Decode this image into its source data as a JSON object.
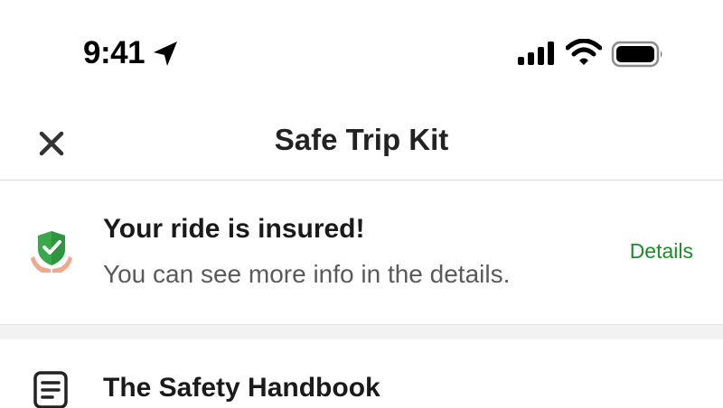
{
  "status_bar": {
    "time": "9:41",
    "icons": [
      "location-arrow-icon",
      "cellular-signal-icon",
      "wifi-icon",
      "battery-icon"
    ]
  },
  "header": {
    "title": "Safe Trip Kit",
    "close_icon": "close-icon"
  },
  "insurance": {
    "icon": "shield-check-icon",
    "title": "Your ride is insured!",
    "subtitle": "You can see more info in the details.",
    "link_label": "Details"
  },
  "handbook": {
    "icon": "document-icon",
    "title": "The Safety Handbook"
  },
  "colors": {
    "accent_green": "#1f8a2e",
    "shield_green": "#3aa84a",
    "hand_color": "#f1a98b",
    "separator_gray": "#f2f2f2"
  }
}
